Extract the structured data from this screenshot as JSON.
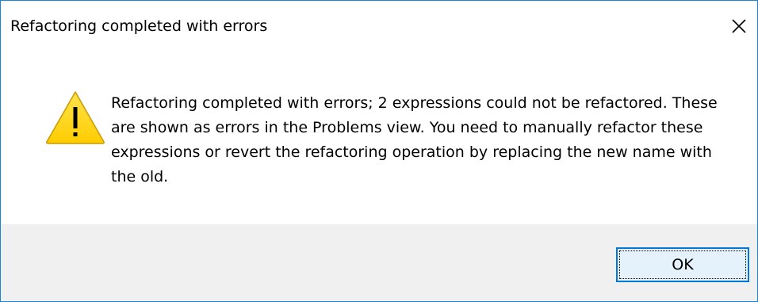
{
  "dialog": {
    "title": "Refactoring completed with errors",
    "message": "Refactoring completed with errors; 2 expressions could not be refactored. These are shown as errors in the Problems view. You need to manually refactor these expressions or revert the refactoring operation by replacing the new name with the old.",
    "icon": "warning-icon",
    "buttons": {
      "ok_label": "OK"
    },
    "close_icon": "close-icon"
  },
  "colors": {
    "border": "#1883d7",
    "footer_bg": "#f0f0f0",
    "button_bg": "#e5f1fb",
    "button_border": "#0078d7",
    "warning_fill": "#ffd800"
  }
}
